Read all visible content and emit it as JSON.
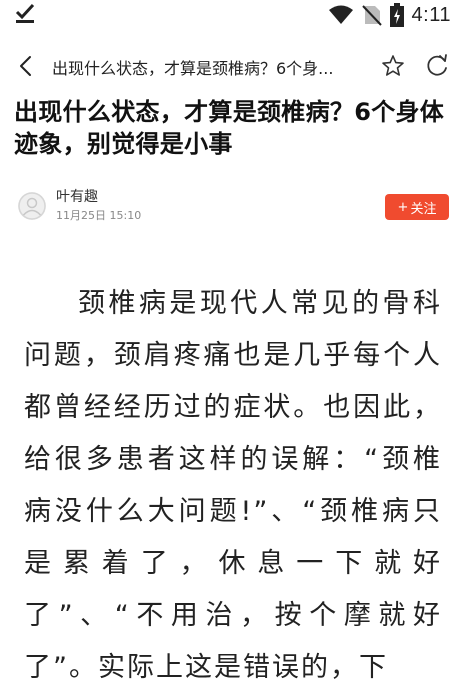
{
  "status_bar": {
    "time": "4:11",
    "icons": [
      "download-done-icon",
      "wifi-icon",
      "no-sim-icon",
      "battery-charging-icon"
    ]
  },
  "nav": {
    "title": "出现什么状态，才算是颈椎病？6个身...",
    "icons": [
      "back-arrow-icon",
      "star-icon",
      "refresh-icon"
    ]
  },
  "article": {
    "headline": "出现什么状态，才算是颈椎病？6个身体迹象，别觉得是小事",
    "author": "叶有趣",
    "time": "11月25日 15:10",
    "follow_label": "关注",
    "follow_plus": "+",
    "body": "颈椎病是现代人常见的骨科问题，颈肩疼痛也是几乎每个人都曾经经历过的症状。也因此，给很多患者这样的误解：“颈椎病没什么大问题!”、“颈椎病只是累着了，休息一下就好了”、“不用治，按个摩就好了”。实际上这是错误的，下"
  },
  "colors": {
    "accent": "#f04b2f",
    "text": "#222222",
    "muted": "#888888"
  }
}
